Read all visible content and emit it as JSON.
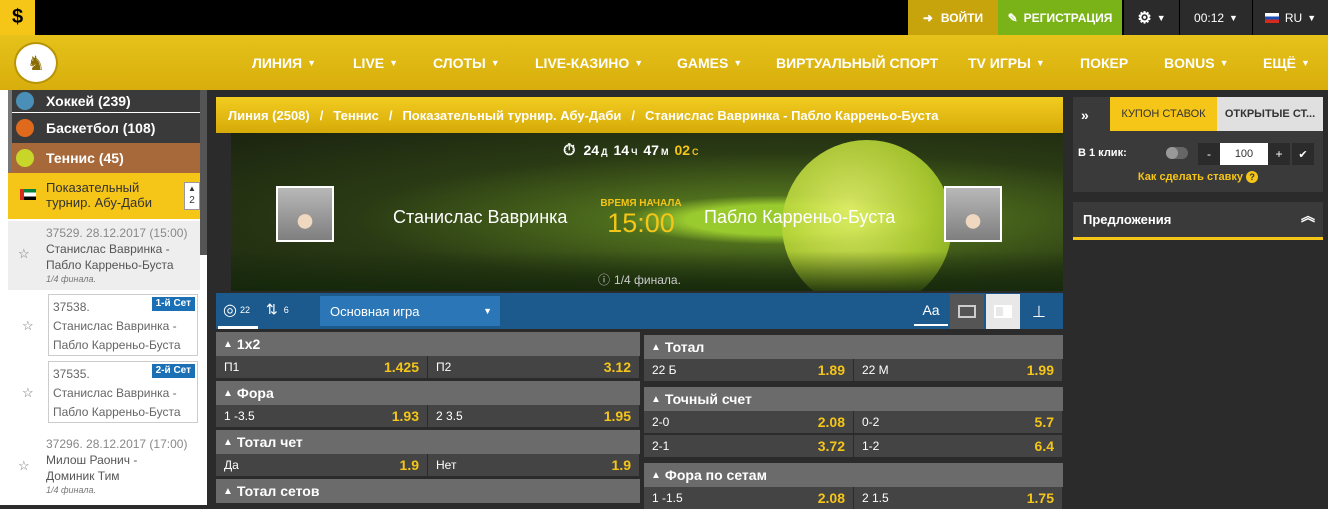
{
  "topbar": {
    "login": "ВОЙТИ",
    "register": "РЕГИСТРАЦИЯ",
    "time": "00:12",
    "lang": "RU"
  },
  "nav": [
    "ЛИНИЯ",
    "LIVE",
    "СЛОТЫ",
    "LIVE-КАЗИНО",
    "GAMES",
    "ВИРТУАЛЬНЫЙ СПОРТ",
    "TV ИГРЫ",
    "ПОКЕР",
    "BONUS",
    "ЕЩЁ"
  ],
  "sidebar": {
    "sports": [
      {
        "label": "Хоккей (239)",
        "color": "#4a8fb8"
      },
      {
        "label": "Баскетбол (108)",
        "color": "#e06a1c"
      },
      {
        "label": "Теннис (45)",
        "color": "#c8d629"
      }
    ],
    "tournament": "Показательный турнир. Абу-Даби",
    "tournament_count": "2",
    "events": [
      {
        "id": "37529. 28.12.2017 (15:00)",
        "name": "Станислас Вавринка - Пабло Карреньо-Буста",
        "stage": "1/4 финала."
      },
      {
        "id": "37296. 28.12.2017 (17:00)",
        "name": "Милош Раонич - Доминик Тим",
        "stage": "1/4 финала."
      }
    ],
    "subevents": [
      {
        "id": "37538.",
        "name": "Станислас Вавринка - Пабло Карреньо-Буста",
        "badge": "1-й Сет"
      },
      {
        "id": "37535.",
        "name": "Станислас Вавринка - Пабло Карреньо-Буста",
        "badge": "2-й Сет"
      }
    ]
  },
  "breadcrumb": [
    "Линия (2508)",
    "Теннис",
    "Показательный турнир. Абу-Даби",
    "Станислас Вавринка - Пабло Карреньо-Буста"
  ],
  "match": {
    "countdown": {
      "d": "24",
      "h": "14",
      "m": "47",
      "s": "02",
      "d_unit": "Д",
      "h_unit": "Ч",
      "m_unit": "М",
      "s_unit": "С"
    },
    "player1": "Станислас Вавринка",
    "player2": "Пабло Карреньо-Буста",
    "start_label": "ВРЕМЯ НАЧАЛА",
    "start_time": "15:00",
    "stage": "1/4 финала."
  },
  "markets_bar": {
    "count1": "22",
    "count2": "6",
    "select": "Основная игра",
    "aa": "Aa"
  },
  "markets_left": [
    {
      "title": "1x2",
      "rows": [
        [
          [
            "П1",
            "1.425"
          ],
          [
            "П2",
            "3.12"
          ]
        ]
      ]
    },
    {
      "title": "Фора",
      "rows": [
        [
          [
            "1 -3.5",
            "1.93"
          ],
          [
            "2 3.5",
            "1.95"
          ]
        ]
      ]
    },
    {
      "title": "Тотал чет",
      "rows": [
        [
          [
            "Да",
            "1.9"
          ],
          [
            "Нет",
            "1.9"
          ]
        ]
      ]
    },
    {
      "title": "Тотал сетов",
      "rows": []
    }
  ],
  "markets_right": [
    {
      "title": "Тотал",
      "rows": [
        [
          [
            "22 Б",
            "1.89"
          ],
          [
            "22 М",
            "1.99"
          ]
        ]
      ]
    },
    {
      "title": "Точный счет",
      "rows": [
        [
          [
            "2-0",
            "2.08"
          ],
          [
            "0-2",
            "5.7"
          ]
        ],
        [
          [
            "2-1",
            "3.72"
          ],
          [
            "1-2",
            "6.4"
          ]
        ]
      ]
    },
    {
      "title": "Фора по сетам",
      "rows": [
        [
          [
            "1 -1.5",
            "2.08"
          ],
          [
            "2 1.5",
            "1.75"
          ]
        ]
      ]
    }
  ],
  "coupon": {
    "tab1": "КУПОН СТАВОК",
    "tab2": "ОТКРЫТЫЕ СТ...",
    "oneclick": "В 1 клик:",
    "amount": "100",
    "howto": "Как сделать ставку"
  },
  "offers": "Предложения",
  "colors": {
    "accent": "#f5c518",
    "register": "#7ab317",
    "blue": "#1c5a8d"
  }
}
